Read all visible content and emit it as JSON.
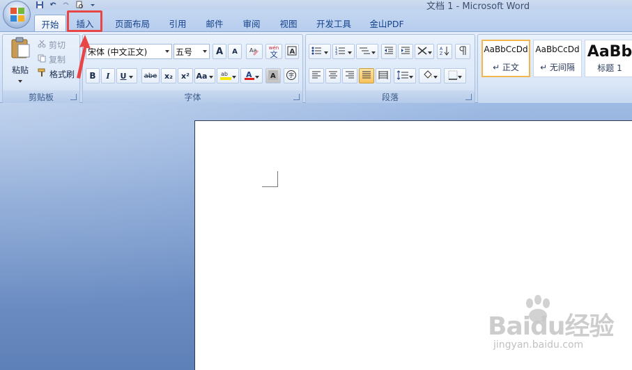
{
  "window": {
    "title": "文档 1 - Microsoft Word"
  },
  "tabs": [
    {
      "label": "开始",
      "active": true
    },
    {
      "label": "插入",
      "highlighted": true
    },
    {
      "label": "页面布局"
    },
    {
      "label": "引用"
    },
    {
      "label": "邮件"
    },
    {
      "label": "审阅"
    },
    {
      "label": "视图"
    },
    {
      "label": "开发工具"
    },
    {
      "label": "金山PDF"
    }
  ],
  "clipboard": {
    "group_label": "剪贴板",
    "paste_label": "粘贴",
    "cut_label": "剪切",
    "copy_label": "复制",
    "format_painter_label": "格式刷"
  },
  "font": {
    "group_label": "字体",
    "font_name": "宋体 (中文正文)",
    "font_size": "五号",
    "bold": "B",
    "italic": "I",
    "underline": "U",
    "strikethrough": "abe",
    "subscript": "x₂",
    "superscript": "x²",
    "change_case": "Aa",
    "grow_font": "A",
    "shrink_font": "A",
    "phonetic": "wén",
    "phonetic_char": "文",
    "highlight_color": "#f7e600",
    "font_color": "#e01e1e"
  },
  "paragraph": {
    "group_label": "段落"
  },
  "styles": {
    "items": [
      {
        "sample": "AaBbCcDd",
        "name": "↵ 正文",
        "selected": true
      },
      {
        "sample": "AaBbCcDd",
        "name": "↵ 无间隔"
      },
      {
        "sample": "AaBb",
        "name": "标题 1"
      }
    ]
  },
  "watermark": {
    "brand": "Baidu经验",
    "url": "jingyan.baidu.com"
  },
  "colors": {
    "highlight_box": "#e84646",
    "tab_text": "#15428b"
  }
}
